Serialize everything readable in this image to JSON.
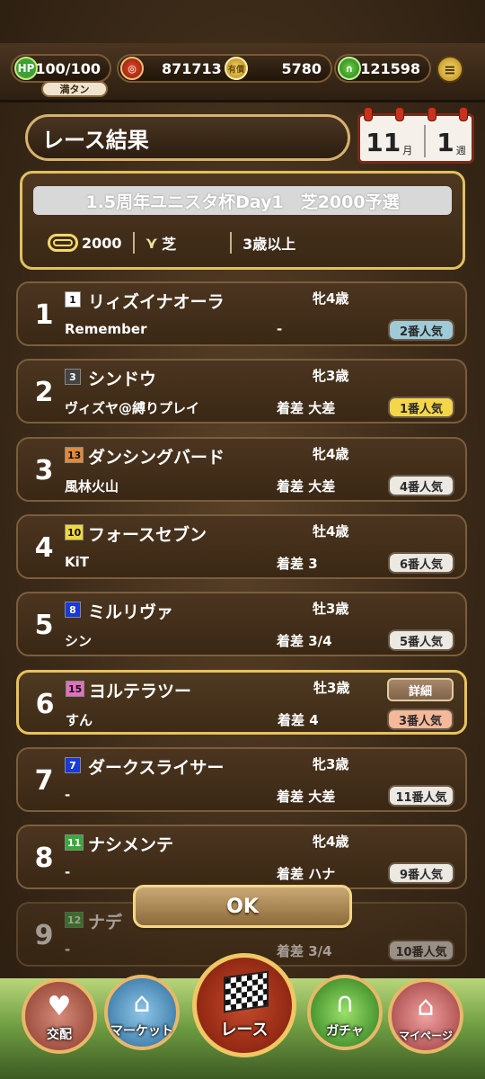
{
  "header": {
    "hp_icon": "HP",
    "hp_value": "100/100",
    "hp_status": "満タン",
    "coin_value": "871713",
    "paid_label": "有償",
    "paid_value": "5780",
    "shoe_value": "121598",
    "menu_icon": "menu-icon"
  },
  "title": "レース結果",
  "calendar": {
    "month": "11",
    "month_unit": "月",
    "week": "1",
    "week_unit": "週"
  },
  "race": {
    "name": "1.5周年ユニスタ杯Day1　芝2000予選",
    "distance": "2000",
    "surface": "芝",
    "condition": "3歳以上"
  },
  "results": [
    {
      "rank": "1",
      "gate": "1",
      "gate_bg": "#ffffff",
      "gate_fg": "#111111",
      "horse": "リィズイナオーラ",
      "sexage": "牝4歳",
      "trainer": "Remember",
      "margin": "-",
      "popularity": "2番人気",
      "pop_style": "blue"
    },
    {
      "rank": "2",
      "gate": "3",
      "gate_bg": "#444444",
      "gate_fg": "#ffffff",
      "horse": "シンドウ",
      "sexage": "牝3歳",
      "trainer": "ヴィズヤ@縛りプレイ",
      "margin": "着差 大差",
      "popularity": "1番人気",
      "pop_style": "yellow"
    },
    {
      "rank": "3",
      "gate": "13",
      "gate_bg": "#e08a3a",
      "gate_fg": "#111111",
      "horse": "ダンシングバード",
      "sexage": "牝4歳",
      "trainer": "風林火山",
      "margin": "着差 大差",
      "popularity": "4番人気",
      "pop_style": "white"
    },
    {
      "rank": "4",
      "gate": "10",
      "gate_bg": "#f0d83a",
      "gate_fg": "#111111",
      "horse": "フォースセブン",
      "sexage": "牡4歳",
      "trainer": "KiT",
      "margin": "着差 3",
      "popularity": "6番人気",
      "pop_style": "white"
    },
    {
      "rank": "5",
      "gate": "8",
      "gate_bg": "#1a3ad8",
      "gate_fg": "#ffffff",
      "horse": "ミルリヴァ",
      "sexage": "牡3歳",
      "trainer": "シン",
      "margin": "着差 3/4",
      "popularity": "5番人気",
      "pop_style": "white"
    },
    {
      "rank": "6",
      "gate": "15",
      "gate_bg": "#e070c0",
      "gate_fg": "#111111",
      "horse": "ヨルテラツー",
      "sexage": "牡3歳",
      "trainer": "すん",
      "margin": "着差 4",
      "popularity": "3番人気",
      "pop_style": "orange"
    },
    {
      "rank": "7",
      "gate": "7",
      "gate_bg": "#1a3ad8",
      "gate_fg": "#ffffff",
      "horse": "ダークスライサー",
      "sexage": "牝3歳",
      "trainer": "-",
      "margin": "着差 大差",
      "popularity": "11番人気",
      "pop_style": "white"
    },
    {
      "rank": "8",
      "gate": "11",
      "gate_bg": "#3aa83a",
      "gate_fg": "#ffffff",
      "horse": "ナシメンテ",
      "sexage": "牝4歳",
      "trainer": "-",
      "margin": "着差 ハナ",
      "popularity": "9番人気",
      "pop_style": "white"
    },
    {
      "rank": "9",
      "gate": "12",
      "gate_bg": "#3aa83a",
      "gate_fg": "#ffffff",
      "horse": "ナデ",
      "sexage": "",
      "trainer": "-",
      "margin": "着差 3/4",
      "popularity": "10番人気",
      "pop_style": "white"
    }
  ],
  "detail_label": "詳細",
  "ok_label": "OK",
  "nav": {
    "breeding": "交配",
    "market": "マーケット",
    "race": "レース",
    "gacha": "ガチャ",
    "mypage": "マイページ"
  }
}
